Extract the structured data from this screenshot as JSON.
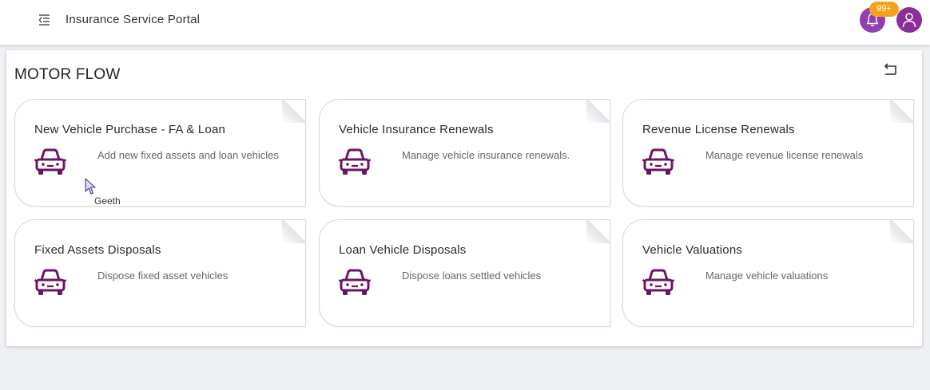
{
  "header": {
    "app_title": "Insurance Service Portal",
    "menu_icon": "menu-collapse-icon",
    "notification_count": "99+",
    "bell_icon": "bell-icon",
    "avatar_icon": "user-icon"
  },
  "page": {
    "title": "MOTOR FLOW",
    "back_icon": "return-icon"
  },
  "cards": [
    {
      "title": "New Vehicle Purchase - FA & Loan",
      "description": "Add new fixed assets and loan vehicles",
      "icon": "car-icon"
    },
    {
      "title": "Vehicle Insurance Renewals",
      "description": "Manage vehicle insurance renewals.",
      "icon": "car-icon"
    },
    {
      "title": "Revenue License Renewals",
      "description": "Manage revenue license renewals",
      "icon": "car-icon"
    },
    {
      "title": "Fixed Assets Disposals",
      "description": "Dispose fixed asset vehicles",
      "icon": "car-icon"
    },
    {
      "title": "Loan Vehicle Disposals",
      "description": "Dispose loans settled vehicles",
      "icon": "car-icon"
    },
    {
      "title": "Vehicle Valuations",
      "description": "Manage vehicle valuations",
      "icon": "car-icon"
    }
  ],
  "tooltip": {
    "text": "Geeth"
  },
  "colors": {
    "accent": "#8b2e96",
    "icon": "#6b1466",
    "badge": "#f5a21b",
    "background": "#eff0f4"
  }
}
